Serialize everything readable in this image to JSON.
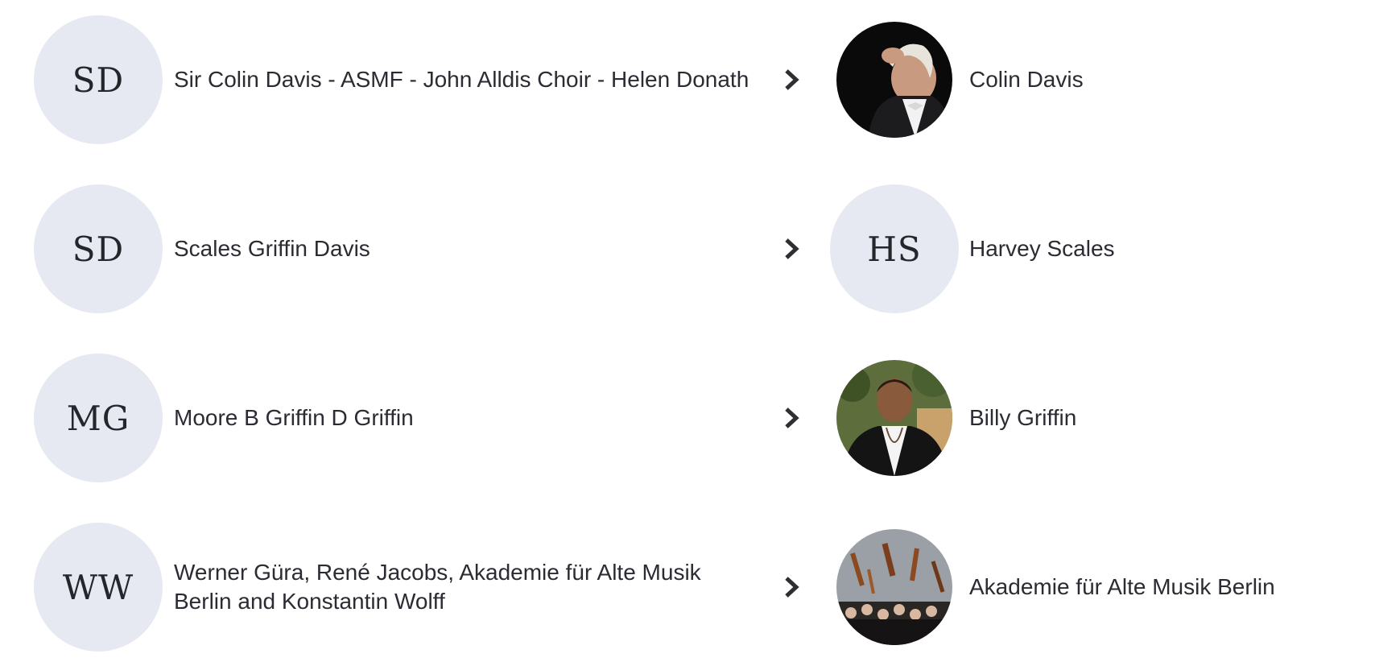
{
  "mappings": [
    {
      "source": {
        "initials": "SD",
        "name": "Sir Colin Davis - ASMF - John Alldis Choir - Helen Donath"
      },
      "target": {
        "kind": "photo",
        "photo": "conductor-portrait",
        "name": "Colin Davis"
      }
    },
    {
      "source": {
        "initials": "SD",
        "name": "Scales Griffin Davis"
      },
      "target": {
        "kind": "initials",
        "initials": "HS",
        "name": "Harvey Scales"
      }
    },
    {
      "source": {
        "initials": "MG",
        "name": "Moore B Griffin  D Griffin"
      },
      "target": {
        "kind": "photo",
        "photo": "singer-portrait",
        "name": "Billy Griffin"
      }
    },
    {
      "source": {
        "initials": "WW",
        "name": "Werner Güra, René Jacobs, Akademie für Alte Musik Berlin and Konstantin Wolff"
      },
      "target": {
        "kind": "photo",
        "photo": "orchestra-group-photo",
        "name": "Akademie für Alte Musik Berlin"
      }
    }
  ],
  "icons": {
    "arrow": "chevron-right-icon"
  },
  "colors": {
    "avatar_bg": "#e6e9f1",
    "text": "#2b2b33",
    "chevron": "#2f2f33"
  }
}
